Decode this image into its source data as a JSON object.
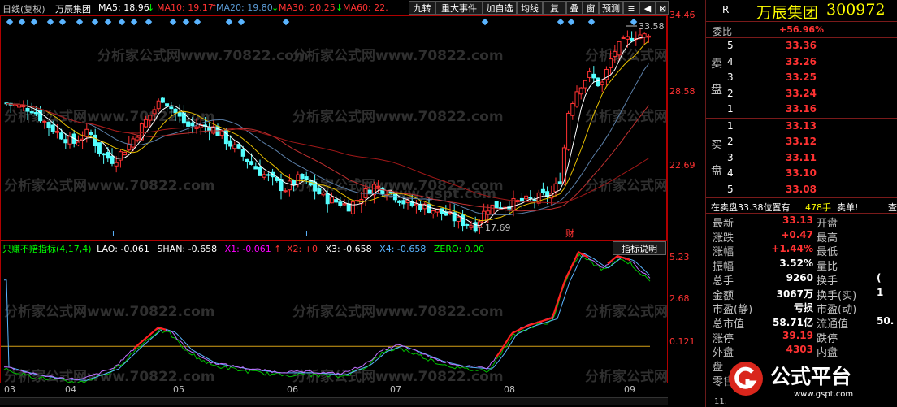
{
  "toolbar": {
    "period": "日线(复权)",
    "stock": "万辰集团",
    "ma5": "MA5: 18.96",
    "ma10": "MA10: 19.17",
    "ma20": "MA20: 19.80",
    "ma30": "MA30: 20.25",
    "ma60": "MA60: 22.",
    "buttons": [
      "九转",
      "重大事件",
      "加自选",
      "均线",
      "复权",
      "叠",
      "窗",
      "预测",
      "≡",
      "⊞"
    ],
    "arrow_up": "↑",
    "arrow_down": "↓"
  },
  "main_chart": {
    "y_labels": [
      "34.46",
      "28.58",
      "22.69"
    ],
    "high_label": "33.58",
    "low_label": "17.69",
    "markers": [
      "L",
      "L",
      "财"
    ],
    "price_range": [
      15.5,
      35.2
    ]
  },
  "indicator": {
    "title": "只赚不赔指标(4,17,4)",
    "lao": "LAO: -0.061",
    "shan": "SHAN: -0.658",
    "x1": "X1: -0.061",
    "x2": "X2: +0",
    "x3": "X3: -0.658",
    "x4": "X4: -0.658",
    "zero": "ZERO: 0.00",
    "help_button": "指标说明",
    "y_labels": [
      "5.23",
      "2.68",
      "0.121"
    ],
    "range": [
      -1.8,
      5.6
    ]
  },
  "time_axis": {
    "labels": [
      "03",
      "04",
      "05",
      "06",
      "07",
      "08",
      "09"
    ]
  },
  "quote": {
    "r_label": "R",
    "name": "万辰集团",
    "code": "300972",
    "weibi_label": "委比",
    "weibi_value": "+56.96%",
    "sell_side": [
      "卖",
      "盘"
    ],
    "buy_side": [
      "买",
      "盘"
    ],
    "asks": [
      {
        "level": "5",
        "price": "33.36"
      },
      {
        "level": "4",
        "price": "33.26"
      },
      {
        "level": "3",
        "price": "33.25"
      },
      {
        "level": "2",
        "price": "33.24"
      },
      {
        "level": "1",
        "price": "33.16"
      }
    ],
    "bids": [
      {
        "level": "1",
        "price": "33.13"
      },
      {
        "level": "2",
        "price": "33.12"
      },
      {
        "level": "3",
        "price": "33.11"
      },
      {
        "level": "4",
        "price": "33.10"
      },
      {
        "level": "5",
        "price": "33.08"
      }
    ],
    "notice_prefix": "在卖盘33.38位置有",
    "notice_volume": "478手",
    "notice_action": "卖单!",
    "notice_more": "查",
    "stats": [
      {
        "l1": "最新",
        "v1": "33.13",
        "l2": "开盘",
        "v2": ""
      },
      {
        "l1": "涨跌",
        "v1": "+0.47",
        "l2": "最高",
        "v2": ""
      },
      {
        "l1": "涨幅",
        "v1": "+1.44%",
        "l2": "最低",
        "v2": ""
      },
      {
        "l1": "振幅",
        "v1": "3.52%",
        "l2": "量比",
        "v2": ""
      },
      {
        "l1": "总手",
        "v1": "9260",
        "l2": "换手",
        "v2": "("
      },
      {
        "l1": "金额",
        "v1": "3067万",
        "l2": "换手(实)",
        "v2": "1"
      },
      {
        "l1": "市盈(静)",
        "v1": "亏损",
        "l2": "市盈(动)",
        "v2": ""
      },
      {
        "l1": "总市值",
        "v1": "58.71亿",
        "l2": "流通值",
        "v2": "50."
      },
      {
        "l1": "涨停",
        "v1": "39.19",
        "l2": "跌停",
        "v2": ""
      },
      {
        "l1": "外盘",
        "v1": "4303",
        "l2": "内盘",
        "v2": ""
      },
      {
        "l1": "盘",
        "v1": "",
        "l2": "",
        "v2": ""
      },
      {
        "l1": "零售",
        "v1": "",
        "l2": "",
        "v2": ""
      }
    ],
    "bottom_partial": "11."
  },
  "watermarks": {
    "text_a": "分析家公式网www.70822.com",
    "text_b": "www.gspt.com"
  },
  "logo": {
    "text": "公式平台",
    "url": "www.gspt.com"
  },
  "colors": {
    "up": "#ff3232",
    "down": "#54ffff",
    "ma5": "#ffffff",
    "ma10": "#ffff00",
    "ma20": "#ff00ff",
    "ma30": "#00ff00",
    "ma60": "#ff0000",
    "panel_border": "#b00000",
    "grid": "#5a0000"
  }
}
